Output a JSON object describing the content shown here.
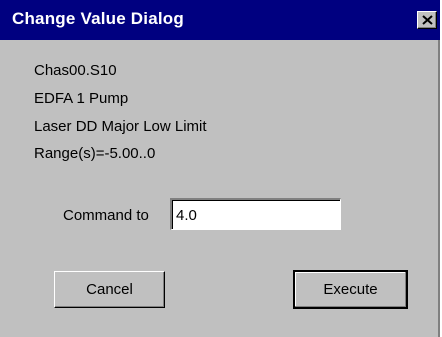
{
  "window": {
    "title": "Change Value Dialog",
    "close_icon": "close-icon"
  },
  "info": {
    "chassis": "Chas00.S10",
    "component": "EDFA 1 Pump",
    "parameter": "Laser DD Major Low Limit",
    "range": "Range(s)=-5.00..0"
  },
  "command": {
    "label": "Command to",
    "value": "4.0"
  },
  "buttons": {
    "cancel": "Cancel",
    "execute": "Execute"
  },
  "colors": {
    "titlebar": "#000080",
    "face": "#c0c0c0"
  }
}
